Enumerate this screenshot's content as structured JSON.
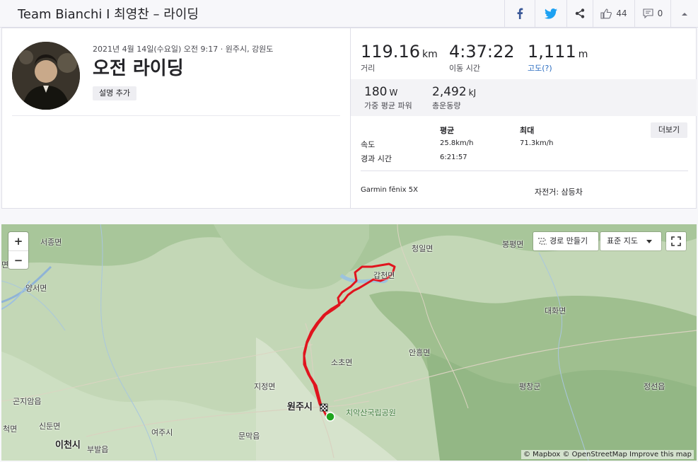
{
  "header": {
    "title": "Team Bianchi I 최영찬 – 라이딩",
    "kudos_count": "44",
    "comment_count": "0"
  },
  "activity": {
    "datetime_location": "2021년 4월 14일(수요일) 오전 9:17 · 원주시, 강원도",
    "title": "오전 라이딩",
    "add_description_label": "설명 추가"
  },
  "stats": {
    "distance": {
      "value": "119.16",
      "unit": "km",
      "label": "거리"
    },
    "moving_time": {
      "value": "4:37:22",
      "label": "이동 시간"
    },
    "elevation": {
      "value": "1,111",
      "unit": "m",
      "label": "고도(?)"
    },
    "weighted_power": {
      "value": "180",
      "unit": "W",
      "label": "가중 평균 파워"
    },
    "energy": {
      "value": "2,492",
      "unit": "kJ",
      "label": "총운동량"
    }
  },
  "table": {
    "col_avg": "평균",
    "col_max": "최대",
    "more_label": "더보기",
    "rows": [
      {
        "label": "속도",
        "avg": "25.8km/h",
        "max": "71.3km/h"
      },
      {
        "label": "경과 시간",
        "avg": "6:21:57",
        "max": ""
      }
    ],
    "device": "Garmin fēnix 5X",
    "bike": "자전거: 삼등차"
  },
  "map": {
    "zoom_in": "+",
    "zoom_out": "−",
    "create_route_label": "경로 만들기",
    "map_style_label": "표준 지도",
    "attribution": "© Mapbox © OpenStreetMap Improve this map",
    "route_color": "#e0141e",
    "start_color": "#1ea51e",
    "labels": [
      {
        "text": "서종면",
        "kind": "normal"
      },
      {
        "text": "양서면",
        "kind": "normal"
      },
      {
        "text": "청일면",
        "kind": "normal"
      },
      {
        "text": "봉평면",
        "kind": "normal"
      },
      {
        "text": "갑천면",
        "kind": "normal"
      },
      {
        "text": "대화면",
        "kind": "normal"
      },
      {
        "text": "안흥면",
        "kind": "normal"
      },
      {
        "text": "소초면",
        "kind": "normal"
      },
      {
        "text": "지정면",
        "kind": "normal"
      },
      {
        "text": "원주시",
        "kind": "big"
      },
      {
        "text": "치악산국립공원",
        "kind": "park"
      },
      {
        "text": "평창군",
        "kind": "normal"
      },
      {
        "text": "정선읍",
        "kind": "normal"
      },
      {
        "text": "곤지암읍",
        "kind": "normal"
      },
      {
        "text": "신둔면",
        "kind": "normal"
      },
      {
        "text": "여주시",
        "kind": "normal"
      },
      {
        "text": "문막읍",
        "kind": "normal"
      },
      {
        "text": "이천시",
        "kind": "big"
      },
      {
        "text": "부발읍",
        "kind": "normal"
      },
      {
        "text": "척면",
        "kind": "normal"
      },
      {
        "text": "면",
        "kind": "normal"
      }
    ]
  }
}
